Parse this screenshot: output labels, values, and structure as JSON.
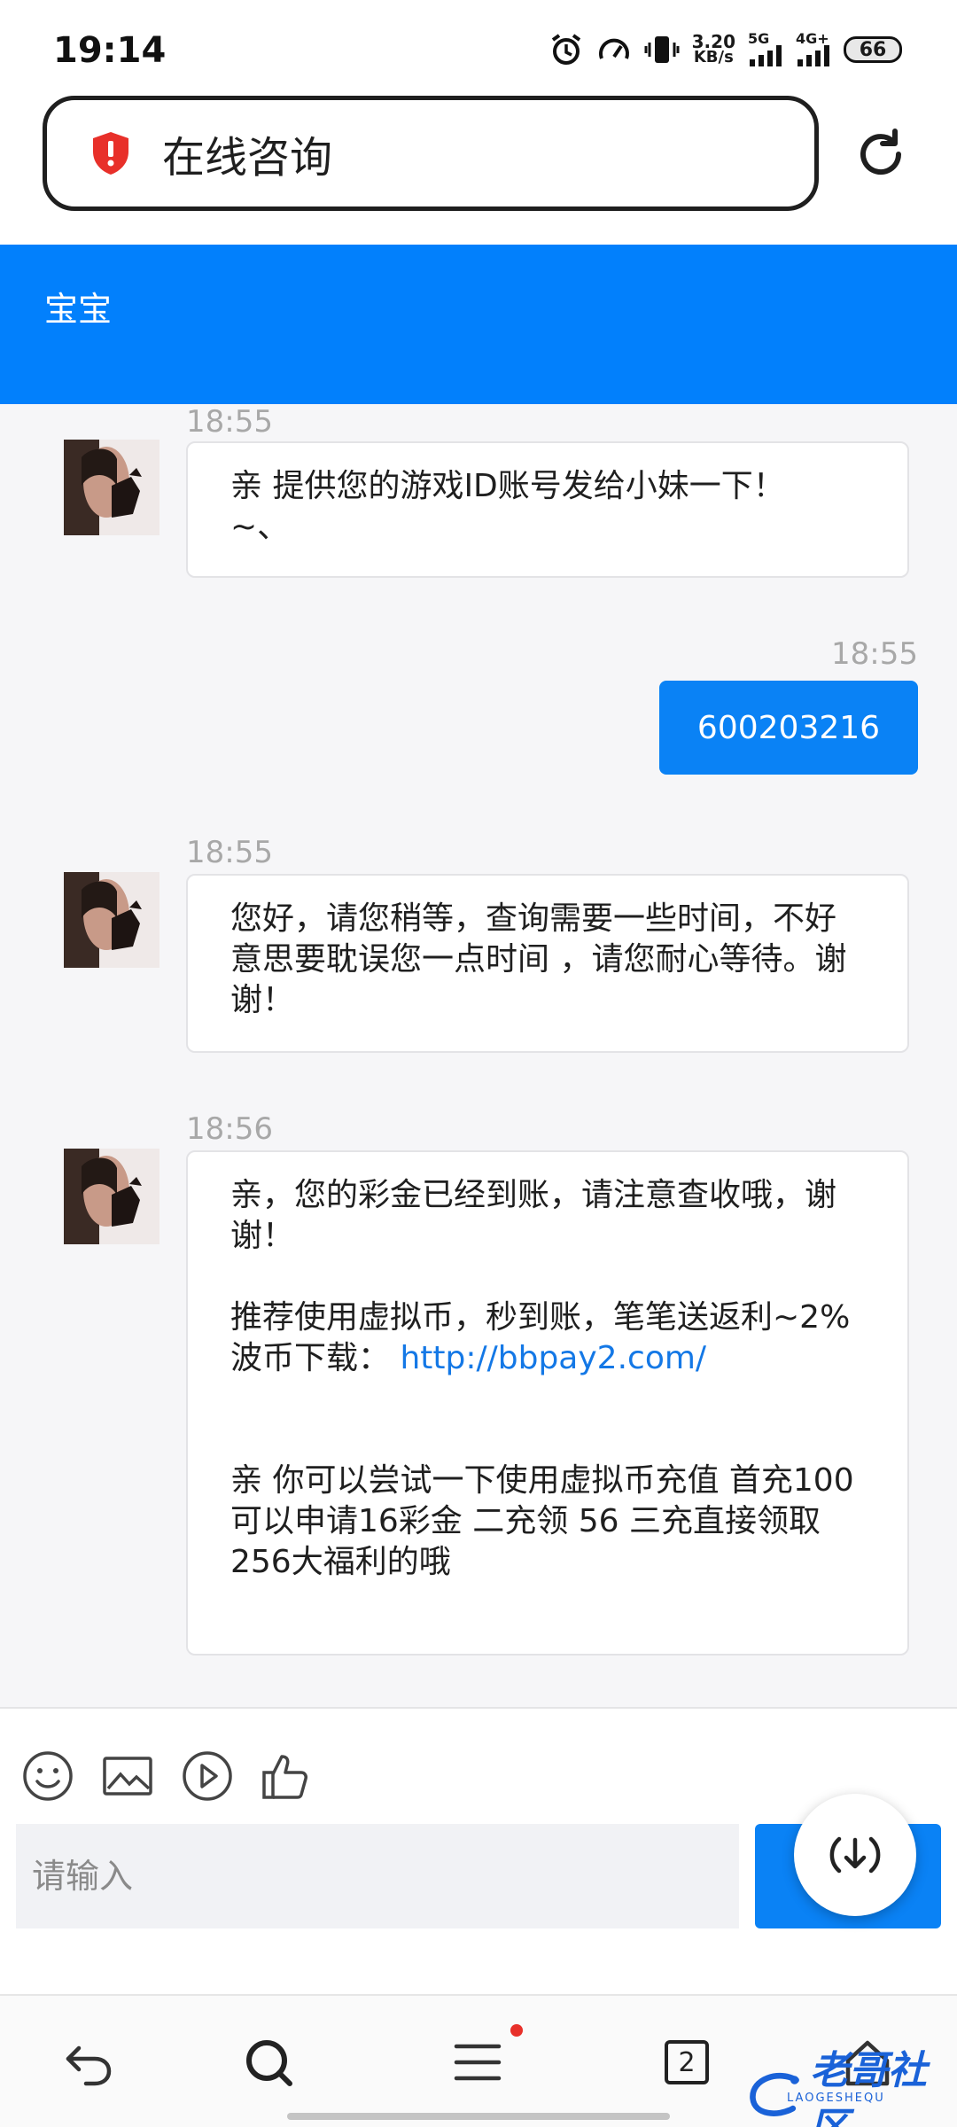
{
  "status_bar": {
    "time": "19:14",
    "speed_value": "3.20",
    "speed_unit": "KB/s",
    "net1": "5G",
    "net2": "4G+",
    "battery": "66"
  },
  "browser": {
    "url_title": "在线咨询",
    "shield_color": "#e8302a"
  },
  "chat": {
    "header_title": "宝宝",
    "accent_color": "#0280fc",
    "messages": [
      {
        "from": "agent",
        "time": "18:55",
        "text": "亲 提供您的游戏ID账号发给小妹一下！\n~、"
      },
      {
        "from": "user",
        "time": "18:55",
        "text": "600203216"
      },
      {
        "from": "agent",
        "time": "18:55",
        "text": "您好，请您稍等，查询需要一些时间，不好意思要耽误您一点时间 ，请您耐心等待。谢谢！"
      },
      {
        "from": "agent",
        "time": "18:56",
        "line1": "亲，您的彩金已经到账，请注意查收哦，谢谢！",
        "line2": "推荐使用虚拟币，秒到账，笔笔送返利~2%",
        "line3_label": "波币下载：",
        "line3_link": "http://bbpay2.com/",
        "line4": "亲 你可以尝试一下使用虚拟币充值 首充100 可以申请16彩金 二充领 56 三充直接领取256大福利的哦"
      }
    ]
  },
  "input": {
    "placeholder": "请输入"
  },
  "tools": [
    "emoji-icon",
    "image-icon",
    "video-icon",
    "thumbs-up-icon"
  ],
  "nav": {
    "tab_count": "2"
  },
  "watermark": {
    "text": "老哥社区",
    "sub": "LAOGESHEQU"
  }
}
